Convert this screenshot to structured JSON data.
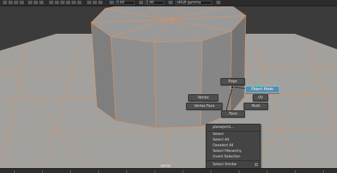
{
  "topbar": {
    "frame_value": "0.00",
    "scale_value": "1.00",
    "colorspace_label": "sRGB gamma"
  },
  "marking_menu": {
    "edge": "Edge",
    "object_mode": "Object Mode",
    "uv": "UV",
    "vertex": "Vertex",
    "vertex_face": "Vertex Face",
    "multi": "Multi",
    "face": "Face"
  },
  "context_menu": {
    "header": "planejoin1...",
    "items": [
      "Select",
      "Select All",
      "Deselect All",
      "Select Hierarchy",
      "Invert Selection",
      "Select Similar"
    ]
  },
  "viewport": {
    "camera_label": "persp"
  },
  "colors": {
    "wire": "#e0915a",
    "mesh": "#8c8c8c",
    "ground": "#a09e9b",
    "background": "#3c3c3c",
    "active_mode": "#5b8ba8"
  }
}
